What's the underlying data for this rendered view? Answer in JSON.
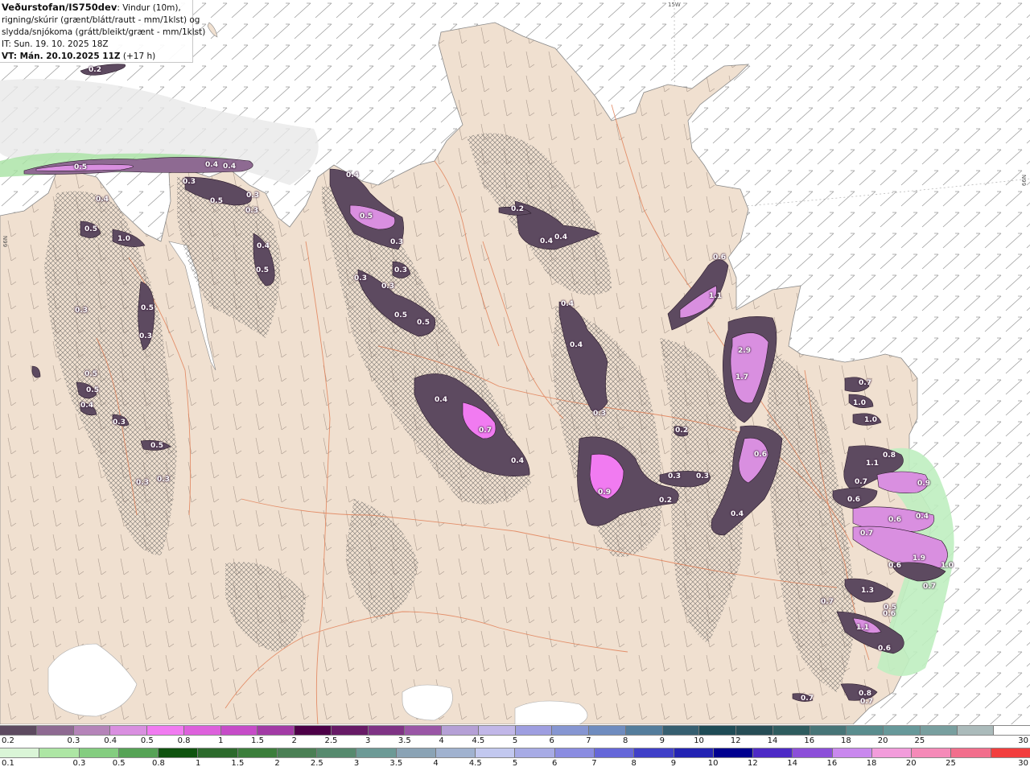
{
  "header": {
    "brand": "Veðurstofan/IS750dev",
    "desc1": ": Vindur (10m),",
    "desc2": "rigning/skúrir (grænt/blátt/rautt - mm/1klst) og",
    "desc3": "slydda/snjókoma (grátt/bleikt/grænt - mm/1klst)",
    "init_time": "IT: Sun. 19. 10. 2025 18Z",
    "valid_time_prefix": "VT: Mán. 20.10.2025 11Z",
    "valid_time_lead": " (+17 h)"
  },
  "graticule": {
    "lon_label": "15W",
    "lat_label_left": "66N",
    "lat_label_right": "66N"
  },
  "colors": {
    "land": "#f0e0d0",
    "sea_hatch": "#9c9c9c",
    "rivers_roads": "#e07a50",
    "hatch": "#555555"
  },
  "precip_labels": [
    {
      "id": "p1",
      "text": "0.2"
    },
    {
      "id": "p2",
      "text": "0.5"
    },
    {
      "id": "p3",
      "text": "0.4"
    },
    {
      "id": "p4",
      "text": "0.4"
    },
    {
      "id": "p5",
      "text": "0.5"
    },
    {
      "id": "p6",
      "text": "0.3"
    },
    {
      "id": "p7",
      "text": "0.3"
    },
    {
      "id": "p8",
      "text": "0.5"
    },
    {
      "id": "p9",
      "text": "1.0"
    },
    {
      "id": "p10",
      "text": "0.4"
    },
    {
      "id": "p11",
      "text": "0.5"
    },
    {
      "id": "p12",
      "text": "0.3"
    },
    {
      "id": "p13",
      "text": "0.3"
    },
    {
      "id": "p14",
      "text": "0.5"
    },
    {
      "id": "p15",
      "text": "0.3"
    },
    {
      "id": "p16",
      "text": "0.5"
    },
    {
      "id": "p17",
      "text": "0.5"
    },
    {
      "id": "p18",
      "text": "0.4"
    },
    {
      "id": "p19",
      "text": "0.3"
    },
    {
      "id": "p20",
      "text": "0.5"
    },
    {
      "id": "p21",
      "text": "0.3"
    },
    {
      "id": "p22",
      "text": "0.3"
    },
    {
      "id": "p23",
      "text": "0.4"
    },
    {
      "id": "p24",
      "text": "0.4"
    },
    {
      "id": "p25",
      "text": "0.5"
    },
    {
      "id": "p26",
      "text": "0.3"
    },
    {
      "id": "p27",
      "text": "0.3"
    },
    {
      "id": "p28",
      "text": "0.3"
    },
    {
      "id": "p29",
      "text": "0.3"
    },
    {
      "id": "p30",
      "text": "0.5"
    },
    {
      "id": "p31",
      "text": "0.5"
    },
    {
      "id": "p32",
      "text": "0.2"
    },
    {
      "id": "p33",
      "text": "0.4"
    },
    {
      "id": "p34",
      "text": "0.4"
    },
    {
      "id": "p35",
      "text": "0.4"
    },
    {
      "id": "p36",
      "text": "0.4"
    },
    {
      "id": "p37",
      "text": "0.3"
    },
    {
      "id": "p38",
      "text": "0.4"
    },
    {
      "id": "p39",
      "text": "0.7"
    },
    {
      "id": "p40",
      "text": "0.4"
    },
    {
      "id": "p41",
      "text": "0.9"
    },
    {
      "id": "p42",
      "text": "0.2"
    },
    {
      "id": "p43",
      "text": "0.3"
    },
    {
      "id": "p44",
      "text": "0.3"
    },
    {
      "id": "p45",
      "text": "0.2"
    },
    {
      "id": "p46",
      "text": "0.6"
    },
    {
      "id": "p47",
      "text": "1.1"
    },
    {
      "id": "p48",
      "text": "2.9"
    },
    {
      "id": "p49",
      "text": "1.7"
    },
    {
      "id": "p50",
      "text": "0.6"
    },
    {
      "id": "p51",
      "text": "0.4"
    },
    {
      "id": "p52",
      "text": "0.7"
    },
    {
      "id": "p53",
      "text": "1.0"
    },
    {
      "id": "p54",
      "text": "1.0"
    },
    {
      "id": "p55",
      "text": "1.1"
    },
    {
      "id": "p56",
      "text": "0.8"
    },
    {
      "id": "p57",
      "text": "0.7"
    },
    {
      "id": "p58",
      "text": "0.9"
    },
    {
      "id": "p59",
      "text": "0.6"
    },
    {
      "id": "p60",
      "text": "0.6"
    },
    {
      "id": "p61",
      "text": "0.4"
    },
    {
      "id": "p62",
      "text": "0.7"
    },
    {
      "id": "p63",
      "text": "1.9"
    },
    {
      "id": "p64",
      "text": "0.6"
    },
    {
      "id": "p65",
      "text": "0.7"
    },
    {
      "id": "p66",
      "text": "1.0"
    },
    {
      "id": "p67",
      "text": "0.7"
    },
    {
      "id": "p68",
      "text": "1.3"
    },
    {
      "id": "p69",
      "text": "0.5"
    },
    {
      "id": "p70",
      "text": "0.6"
    },
    {
      "id": "p71",
      "text": "1.1"
    },
    {
      "id": "p72",
      "text": "0.6"
    },
    {
      "id": "p73",
      "text": "0.8"
    },
    {
      "id": "p74",
      "text": "0.7"
    },
    {
      "id": "p75",
      "text": "0.7"
    }
  ],
  "legend_snow": {
    "colors": [
      "#5d4a60",
      "#8e6a92",
      "#b584b9",
      "#d98fe0",
      "#f17bf1",
      "#dd61dc",
      "#c64cc8",
      "#a23aa5",
      "#4d0048",
      "#671a66",
      "#7f3385",
      "#9a56a6",
      "#b5a0d6",
      "#c1b7e8",
      "#9e9ee0",
      "#8696d2",
      "#6f8cbf",
      "#547d9c",
      "#365f70",
      "#1e4b55",
      "#264d55",
      "#2e5c5e",
      "#477577",
      "#5a8d8e",
      "#67999a",
      "#789f9f",
      "#abbbbb",
      "#ffffff"
    ],
    "ticks": [
      "0.2",
      "0.3",
      "0.4",
      "0.5",
      "0.8",
      "1",
      "1.5",
      "2",
      "2.5",
      "3",
      "3.5",
      "4",
      "4.5",
      "5",
      "6",
      "7",
      "8",
      "9",
      "10",
      "12",
      "14",
      "16",
      "18",
      "20",
      "25",
      "30"
    ]
  },
  "legend_rain": {
    "colors": [
      "#daf5d7",
      "#ade6a4",
      "#84cd80",
      "#56a356",
      "#0f530f",
      "#2c6a2c",
      "#3b7e3b",
      "#4a7f54",
      "#568a6e",
      "#6c9a96",
      "#8aa3b5",
      "#a0b2cf",
      "#c2c8ef",
      "#a7abe5",
      "#8a8ce1",
      "#6567d9",
      "#3f3fc8",
      "#2323b3",
      "#00008f",
      "#4d2ac6",
      "#8c4fd9",
      "#c988ee",
      "#f29cdb",
      "#f58ab8",
      "#f26e8c",
      "#f23e3e"
    ],
    "ticks": [
      "0.1",
      "0.3",
      "0.5",
      "0.8",
      "1",
      "1.5",
      "2",
      "2.5",
      "3",
      "3.5",
      "4",
      "4.5",
      "5",
      "6",
      "7",
      "8",
      "9",
      "10",
      "12",
      "14",
      "16",
      "18",
      "20",
      "25",
      "30"
    ]
  }
}
